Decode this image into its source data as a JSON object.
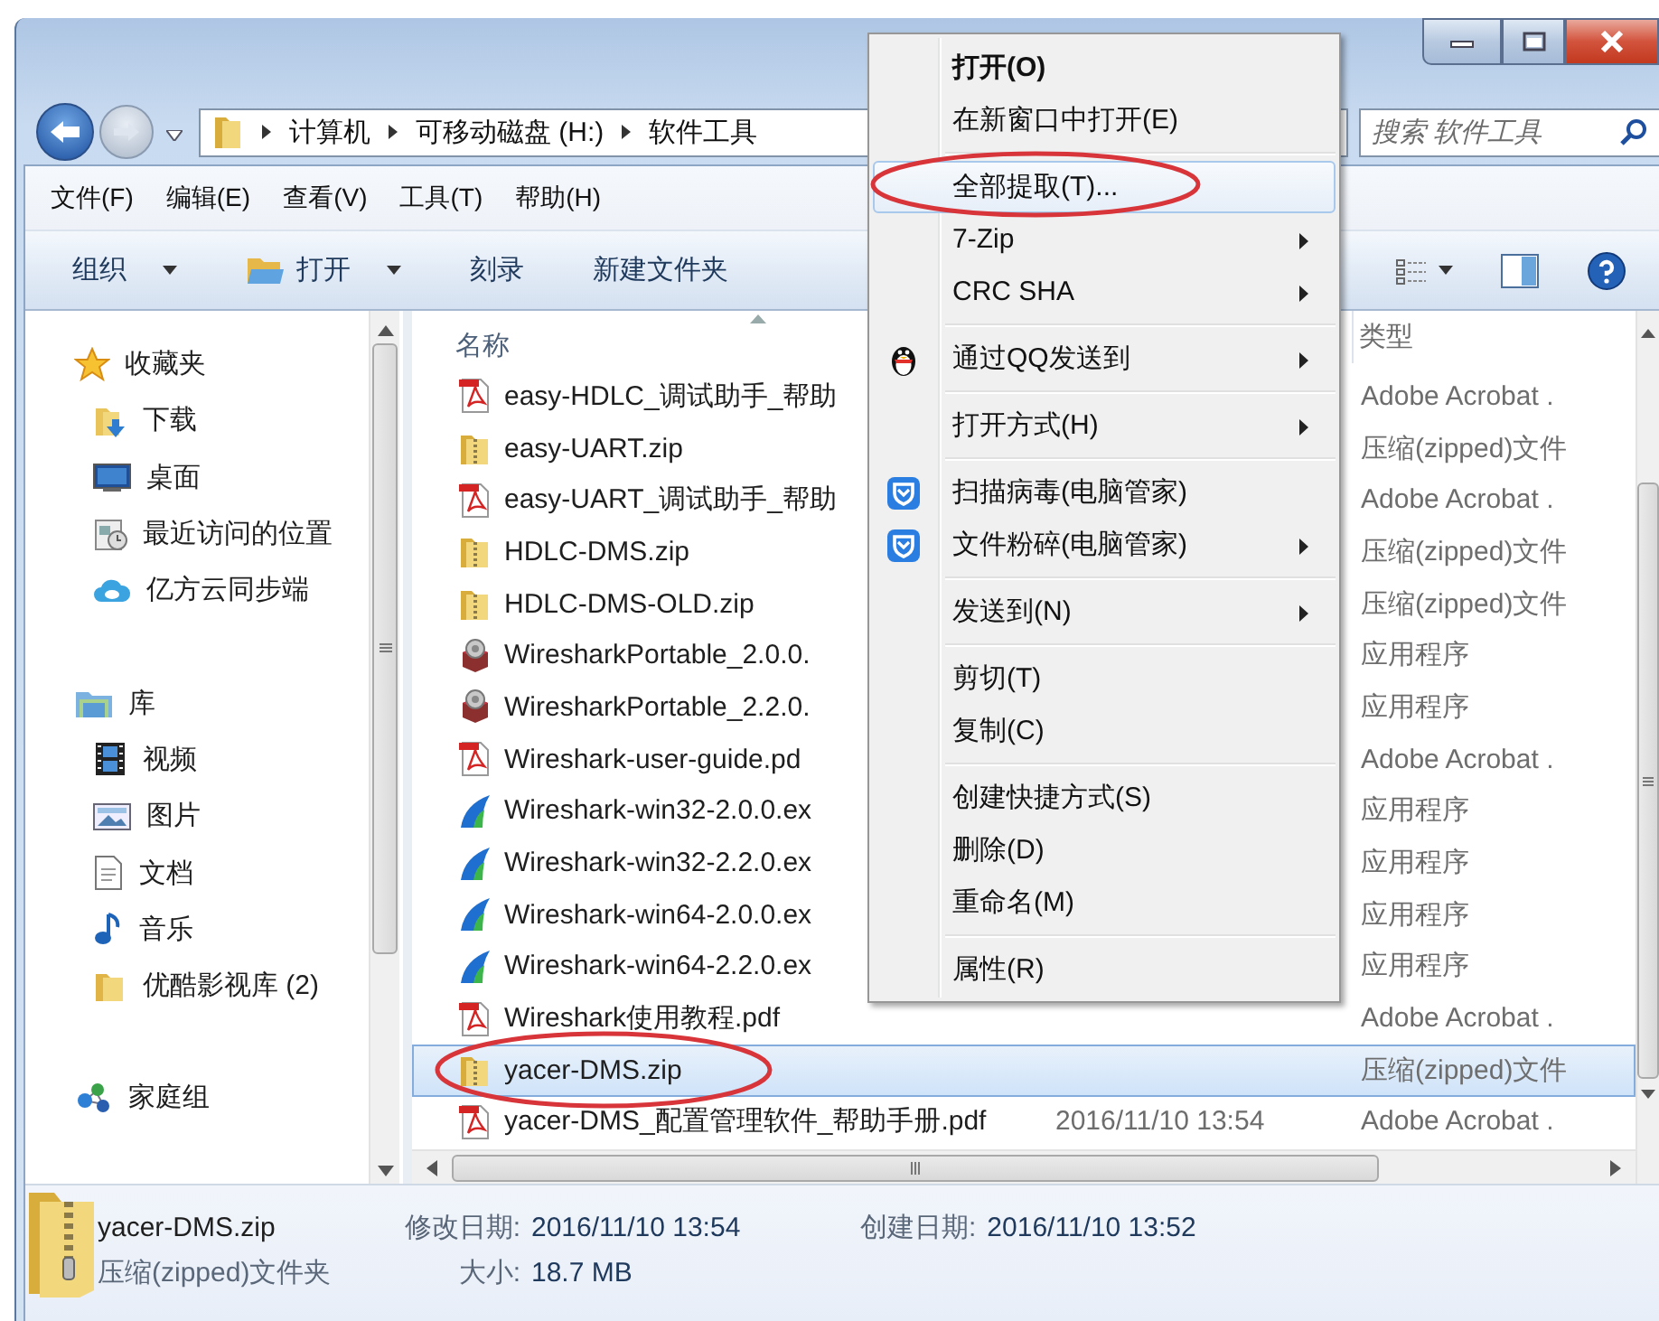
{
  "address_bar": {
    "path": [
      "计算机",
      "可移动磁盘 (H:)",
      "软件工具"
    ],
    "search": {
      "placeholder": "搜索 软件工具"
    }
  },
  "menu_bar": [
    "文件(F)",
    "编辑(E)",
    "查看(V)",
    "工具(T)",
    "帮助(H)"
  ],
  "toolbar": [
    {
      "label": "组织",
      "dropdown": true,
      "has_icon": false
    },
    {
      "label": "打开",
      "dropdown": true,
      "has_icon": true
    },
    {
      "label": "刻录",
      "dropdown": false,
      "has_icon": false
    },
    {
      "label": "新建文件夹",
      "dropdown": false,
      "has_icon": false
    }
  ],
  "nav_pane": [
    {
      "label": "收藏夹",
      "kind": "favorites",
      "children": [
        {
          "label": "下载",
          "kind": "downloads"
        },
        {
          "label": "桌面",
          "kind": "desktop"
        },
        {
          "label": "最近访问的位置",
          "kind": "recent"
        },
        {
          "label": "亿方云同步端",
          "kind": "cloud"
        }
      ]
    },
    {
      "label": "库",
      "kind": "libraries",
      "children": [
        {
          "label": "视频",
          "kind": "videos"
        },
        {
          "label": "图片",
          "kind": "pictures"
        },
        {
          "label": "文档",
          "kind": "documents"
        },
        {
          "label": "音乐",
          "kind": "music"
        },
        {
          "label": "优酷影视库 (2)",
          "kind": "folder"
        }
      ]
    },
    {
      "label": "家庭组",
      "kind": "homegroup"
    }
  ],
  "file_list": {
    "headers": {
      "name": "名称",
      "type": "类型"
    },
    "rows": [
      {
        "name": "easy-HDLC_调试助手_帮助",
        "kind": "pdf",
        "type": "Adobe Acrobat .",
        "selected": false,
        "circled": false
      },
      {
        "name": "easy-UART.zip",
        "kind": "zip",
        "type": "压缩(zipped)文件",
        "selected": false,
        "circled": false
      },
      {
        "name": "easy-UART_调试助手_帮助",
        "kind": "pdf",
        "type": "Adobe Acrobat .",
        "selected": false,
        "circled": false
      },
      {
        "name": "HDLC-DMS.zip",
        "kind": "zip",
        "type": "压缩(zipped)文件",
        "selected": false,
        "circled": false
      },
      {
        "name": "HDLC-DMS-OLD.zip",
        "kind": "zip",
        "type": "压缩(zipped)文件",
        "selected": false,
        "circled": false
      },
      {
        "name": "WiresharkPortable_2.0.0.",
        "kind": "portable",
        "type": "应用程序",
        "selected": false,
        "circled": false
      },
      {
        "name": "WiresharkPortable_2.2.0.",
        "kind": "portable",
        "type": "应用程序",
        "selected": false,
        "circled": false
      },
      {
        "name": "Wireshark-user-guide.pd",
        "kind": "pdf",
        "type": "Adobe Acrobat .",
        "selected": false,
        "circled": false
      },
      {
        "name": "Wireshark-win32-2.0.0.ex",
        "kind": "installer",
        "type": "应用程序",
        "selected": false,
        "circled": false
      },
      {
        "name": "Wireshark-win32-2.2.0.ex",
        "kind": "installer",
        "type": "应用程序",
        "selected": false,
        "circled": false
      },
      {
        "name": "Wireshark-win64-2.0.0.ex",
        "kind": "installer",
        "type": "应用程序",
        "selected": false,
        "circled": false
      },
      {
        "name": "Wireshark-win64-2.2.0.ex",
        "kind": "installer",
        "type": "应用程序",
        "selected": false,
        "circled": false
      },
      {
        "name": "Wireshark使用教程.pdf",
        "kind": "pdf",
        "type": "Adobe Acrobat .",
        "selected": false,
        "circled": false
      },
      {
        "name": "yacer-DMS.zip",
        "kind": "zip",
        "type": "压缩(zipped)文件",
        "selected": true,
        "circled": true
      },
      {
        "name": "yacer-DMS_配置管理软件_帮助手册.pdf",
        "kind": "pdf",
        "date": "2016/11/10 13:54",
        "type": "Adobe Acrobat .",
        "selected": false,
        "circled": false
      }
    ]
  },
  "details": {
    "name": "yacer-DMS.zip",
    "type": "压缩(zipped)文件夹",
    "fields": [
      {
        "label": "修改日期:",
        "value": "2016/11/10 13:54"
      },
      {
        "label": "大小:",
        "value": "18.7 MB"
      },
      {
        "label": "创建日期:",
        "value": "2016/11/10 13:52"
      }
    ]
  },
  "context_menu": {
    "items": [
      {
        "kind": "item",
        "label": "打开(O)",
        "default": true,
        "selected": false,
        "submenu": false,
        "circled": false
      },
      {
        "kind": "item",
        "label": "在新窗口中打开(E)",
        "default": false,
        "selected": false,
        "submenu": false,
        "circled": false
      },
      {
        "kind": "separator"
      },
      {
        "kind": "item",
        "label": "全部提取(T)...",
        "default": false,
        "selected": true,
        "submenu": false,
        "circled": true
      },
      {
        "kind": "item",
        "label": "7-Zip",
        "default": false,
        "selected": false,
        "submenu": true,
        "circled": false
      },
      {
        "kind": "item",
        "label": "CRC SHA",
        "default": false,
        "selected": false,
        "submenu": true,
        "circled": false
      },
      {
        "kind": "separator"
      },
      {
        "kind": "share",
        "label": "通过QQ发送到",
        "default": false,
        "selected": false,
        "submenu": true,
        "circled": false
      },
      {
        "kind": "separator"
      },
      {
        "kind": "item",
        "label": "打开方式(H)",
        "default": false,
        "selected": false,
        "submenu": true,
        "circled": false
      },
      {
        "kind": "separator"
      },
      {
        "kind": "security",
        "label": "扫描病毒(电脑管家)",
        "default": false,
        "selected": false,
        "submenu": false,
        "circled": false
      },
      {
        "kind": "security",
        "label": "文件粉碎(电脑管家)",
        "default": false,
        "selected": false,
        "submenu": true,
        "circled": false
      },
      {
        "kind": "separator"
      },
      {
        "kind": "item",
        "label": "发送到(N)",
        "default": false,
        "selected": false,
        "submenu": true,
        "circled": false
      },
      {
        "kind": "separator"
      },
      {
        "kind": "item",
        "label": "剪切(T)",
        "default": false,
        "selected": false,
        "submenu": false,
        "circled": false
      },
      {
        "kind": "item",
        "label": "复制(C)",
        "default": false,
        "selected": false,
        "submenu": false,
        "circled": false
      },
      {
        "kind": "separator"
      },
      {
        "kind": "item",
        "label": "创建快捷方式(S)",
        "default": false,
        "selected": false,
        "submenu": false,
        "circled": false
      },
      {
        "kind": "item",
        "label": "删除(D)",
        "default": false,
        "selected": false,
        "submenu": false,
        "circled": false
      },
      {
        "kind": "item",
        "label": "重命名(M)",
        "default": false,
        "selected": false,
        "submenu": false,
        "circled": false
      },
      {
        "kind": "separator"
      },
      {
        "kind": "item",
        "label": "属性(R)",
        "default": false,
        "selected": false,
        "submenu": false,
        "circled": false
      }
    ]
  }
}
